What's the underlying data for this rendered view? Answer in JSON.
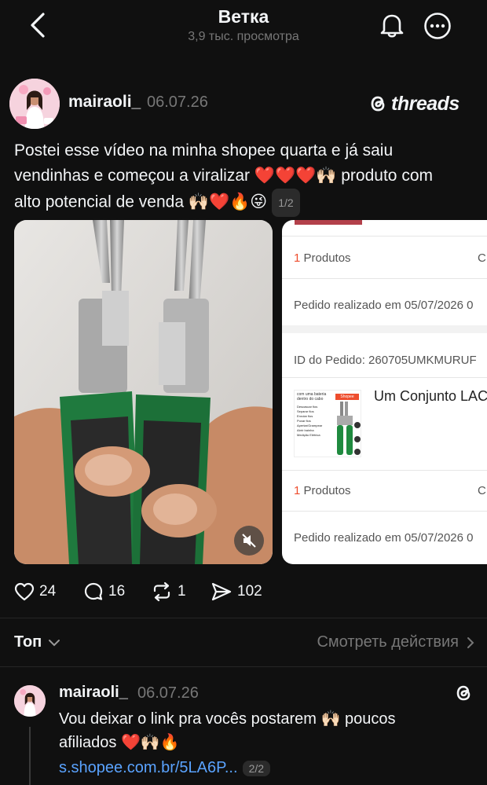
{
  "header": {
    "title": "Ветка",
    "subtitle": "3,9 тыс. просмотра"
  },
  "post": {
    "author": "mairaoli_",
    "date": "06.07.26",
    "brand": "threads",
    "text_line1": "Postei esse vídeo na minha shopee quarta e já saiu",
    "text_line2_pre": "vendinhas e começou a viralizar ",
    "text_line2_emoji": "❤️❤️❤️🙌🏻",
    "text_line2_post": " produto com",
    "text_line3_pre": "alto potencial de venda ",
    "text_line3_emoji": "🙌🏻❤️🔥😜",
    "page_badge": "1/2"
  },
  "order_screenshot": {
    "products_count_1": "1",
    "products_label_1": " Produtos",
    "trailing_1": "C",
    "ordered_on_1": "Pedido realizado em 05/07/2026 0",
    "order_id": "ID do Pedido: 260705UMKMURUF",
    "product_title": "Um Conjunto LAC",
    "products_count_2": "1",
    "products_label_2": " Produtos",
    "trailing_2": "C",
    "ordered_on_2": "Pedido realizado em 05/07/2026 0",
    "thumb_header": "com uma bateria dentro do cabo",
    "thumb_brand": "Shopee",
    "thumb_features": [
      "Descascar fios",
      "Separar fios",
      "Enrolar fios",
      "Puxar fios",
      "Apertar/Grampear",
      "Abrir bainha",
      "Medição Elétrica"
    ]
  },
  "actions": {
    "likes": "24",
    "comments": "16",
    "reposts": "1",
    "shares": "102"
  },
  "filter": {
    "top_label": "Топ",
    "see_activity": "Смотреть действия"
  },
  "reply": {
    "author": "mairaoli_",
    "date": "06.07.26",
    "text_line1_pre": "Vou deixar o link pra vocês postarem ",
    "text_line1_emoji": "🙌🏻",
    "text_line1_post": " poucos",
    "text_line2_pre": "afiliados ",
    "text_line2_emoji": "❤️🙌🏻🔥",
    "link": "s.shopee.com.br/5LA6P...",
    "page_badge": "2/2"
  },
  "colors": {
    "background": "#101010",
    "link": "#5aa3ff",
    "shopee_accent": "#ee4d2d"
  }
}
